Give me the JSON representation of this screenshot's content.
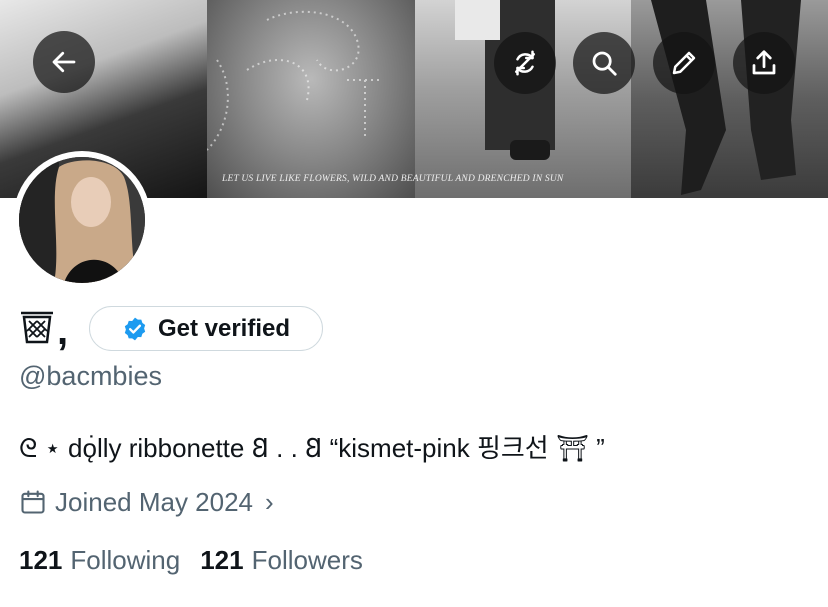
{
  "banner": {
    "caption": "LET US LIVE LIKE FLOWERS, WILD AND BEAUTIFUL AND DRENCHED IN SUN"
  },
  "header_buttons": {
    "back": "back-arrow-icon",
    "refresh": "refresh-icon",
    "search": "search-icon",
    "edit": "pencil-icon",
    "share": "share-icon"
  },
  "profile": {
    "display_name_suffix": ",",
    "verify_label": "Get verified",
    "handle": "@bacmbies",
    "bio": "ᘓ ⋆   dǫ̇lly ribbonette  𐐒 . . 𐐒   “kismet-pink 핑크선  ⛩ ”",
    "joined": "Joined May 2024",
    "following_count": "121",
    "following_label": "Following",
    "followers_count": "121",
    "followers_label": "Followers"
  },
  "colors": {
    "text_primary": "#0f1419",
    "text_secondary": "#536471",
    "verified_blue": "#1d9bf0",
    "border": "#cfd9de"
  }
}
